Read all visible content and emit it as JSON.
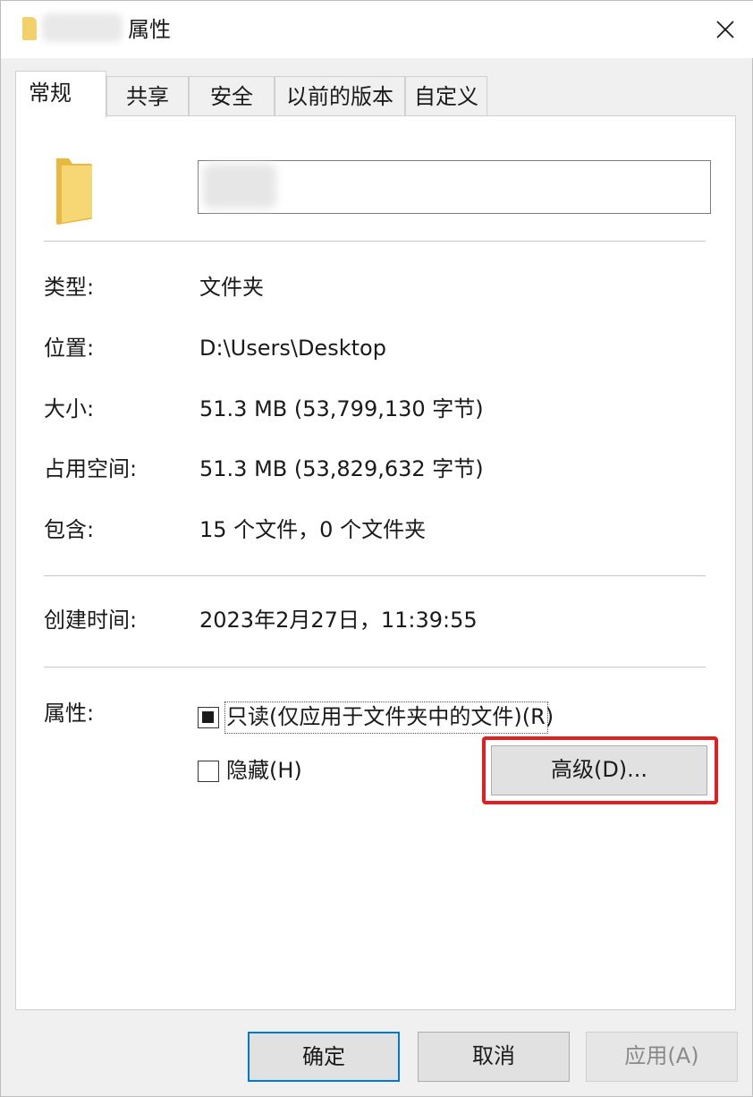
{
  "window": {
    "title": "属性"
  },
  "tabs": [
    {
      "label": "常规",
      "active": true
    },
    {
      "label": "共享"
    },
    {
      "label": "安全"
    },
    {
      "label": "以前的版本"
    },
    {
      "label": "自定义"
    }
  ],
  "general": {
    "name_value": "",
    "rows": [
      {
        "label": "类型:",
        "value": "文件夹"
      },
      {
        "label": "位置:",
        "value": "D:\\Users\\Desktop"
      },
      {
        "label": "大小:",
        "value": "51.3 MB (53,799,130 字节)"
      },
      {
        "label": "占用空间:",
        "value": "51.3 MB (53,829,632 字节)"
      },
      {
        "label": "包含:",
        "value": "15 个文件，0 个文件夹"
      },
      {
        "label": "创建时间:",
        "value": "2023年2月27日，11:39:55"
      }
    ],
    "attributes_label": "属性:",
    "readonly_label": "只读(仅应用于文件夹中的文件)(R)",
    "readonly_state": "indeterminate",
    "hidden_label": "隐藏(H)",
    "hidden_checked": false,
    "advanced_label": "高级(D)..."
  },
  "footer": {
    "ok_label": "确定",
    "cancel_label": "取消",
    "apply_label": "应用(A)"
  },
  "colors": {
    "highlight": "#e02020",
    "default_button_border": "#0078d7",
    "folder": "#f4d06b"
  }
}
